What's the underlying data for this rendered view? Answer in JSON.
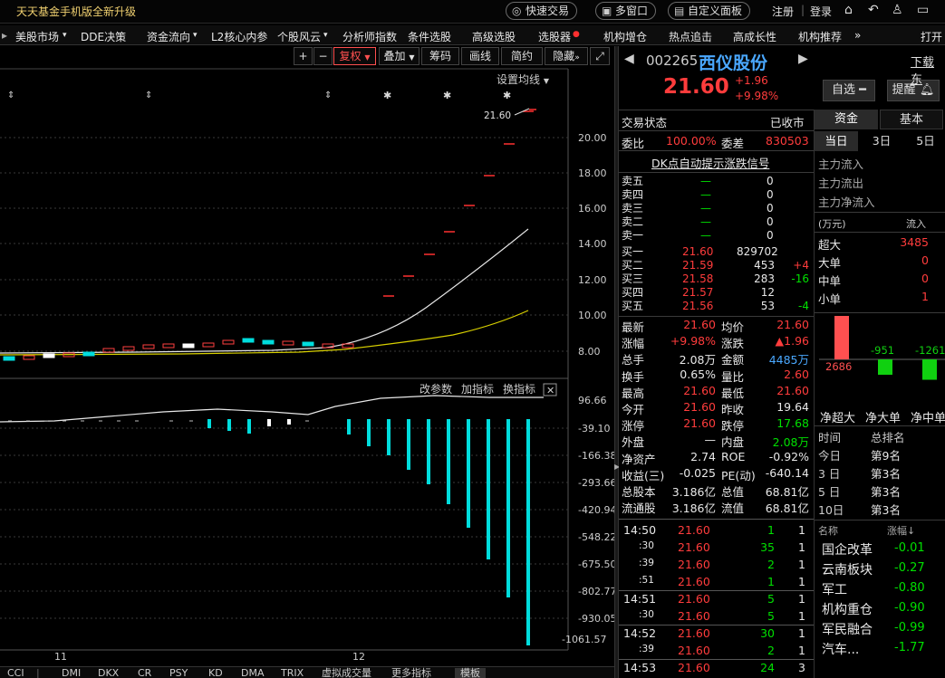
{
  "topbar": {
    "promo": "天天基金手机版全新升级",
    "btn_fast": "快速交易",
    "btn_multi": "多窗口",
    "btn_custom": "自定义面板",
    "register": "注册",
    "login": "登录"
  },
  "menu": [
    "美股市场",
    "DDE决策",
    "资金流向",
    "L2核心内参",
    "个股风云",
    "分析师指数",
    "条件选股",
    "高级选股",
    "选股器",
    "机构增仓",
    "热点追击",
    "高成长性",
    "机构推荐",
    "打开"
  ],
  "chart_toolbar": {
    "plus": "+",
    "minus": "−",
    "fuquan": "复权",
    "overlay": "叠加",
    "chips": "筹码",
    "draw": "画线",
    "simple": "简约",
    "hide": "隐藏",
    "set_ma": "设置均线"
  },
  "chart_labels": {
    "last_price": "21.60",
    "price_ticks": [
      "20.00",
      "18.00",
      "16.00",
      "14.00",
      "12.00",
      "10.00",
      "8.00"
    ],
    "ind_ticks": [
      "96.66",
      "-39.10",
      "-166.38",
      "-293.66",
      "-420.94",
      "-548.22",
      "-675.50",
      "-802.77",
      "-930.05",
      "-1061.57"
    ],
    "x_labels": [
      "11",
      "12"
    ],
    "ind_tools": [
      "改参数",
      "加指标",
      "换指标"
    ]
  },
  "bottom_tabs": [
    "CCI",
    "DMI",
    "DKX",
    "CR",
    "PSY",
    "KD",
    "DMA",
    "TRIX",
    "虚拟成交量",
    "更多指标",
    "模板"
  ],
  "stock": {
    "code": "002265",
    "name": "西仪股份",
    "price": "21.60",
    "change": "+1.96",
    "pct": "+9.98%",
    "add_fav": "自选",
    "alert": "提醒",
    "download": "下载东"
  },
  "quote": {
    "status_label": "交易状态",
    "status": "已收市",
    "wb_label": "委比",
    "wb": "100.00%",
    "wc_label": "委差",
    "wc": "830503",
    "signal": "DK点自动提示涨跌信号",
    "sells": [
      {
        "l": "卖五",
        "p": "—",
        "v": "0"
      },
      {
        "l": "卖四",
        "p": "—",
        "v": "0"
      },
      {
        "l": "卖三",
        "p": "—",
        "v": "0"
      },
      {
        "l": "卖二",
        "p": "—",
        "v": "0"
      },
      {
        "l": "卖一",
        "p": "—",
        "v": "0"
      }
    ],
    "buys": [
      {
        "l": "买一",
        "p": "21.60",
        "v": "829702",
        "d": ""
      },
      {
        "l": "买二",
        "p": "21.59",
        "v": "453",
        "d": "+4"
      },
      {
        "l": "买三",
        "p": "21.58",
        "v": "283",
        "d": "-16"
      },
      {
        "l": "买四",
        "p": "21.57",
        "v": "12",
        "d": ""
      },
      {
        "l": "买五",
        "p": "21.56",
        "v": "53",
        "d": "-4"
      }
    ],
    "stats": [
      {
        "a": "最新",
        "av": "21.60",
        "b": "均价",
        "bv": "21.60"
      },
      {
        "a": "涨幅",
        "av": "+9.98%",
        "b": "涨跌",
        "bv": "▲1.96"
      },
      {
        "a": "总手",
        "av": "2.08万",
        "b": "金额",
        "bv": "4485万"
      },
      {
        "a": "换手",
        "av": "0.65%",
        "b": "量比",
        "bv": "2.60"
      },
      {
        "a": "最高",
        "av": "21.60",
        "b": "最低",
        "bv": "21.60"
      },
      {
        "a": "今开",
        "av": "21.60",
        "b": "昨收",
        "bv": "19.64"
      },
      {
        "a": "涨停",
        "av": "21.60",
        "b": "跌停",
        "bv": "17.68"
      },
      {
        "a": "外盘",
        "av": "—",
        "b": "内盘",
        "bv": "2.08万"
      },
      {
        "a": "净资产",
        "av": "2.74",
        "b": "ROE",
        "bv": "-0.92%"
      },
      {
        "a": "收益(三)",
        "av": "-0.025",
        "b": "PE(动)",
        "bv": "-640.14"
      },
      {
        "a": "总股本",
        "av": "3.186亿",
        "b": "总值",
        "bv": "68.81亿"
      },
      {
        "a": "流通股",
        "av": "3.186亿",
        "b": "流值",
        "bv": "68.81亿"
      }
    ],
    "ticks": [
      {
        "t": "14:50",
        "p": "21.60",
        "v": "1",
        "n": "1"
      },
      {
        "t": ":30",
        "p": "21.60",
        "v": "35",
        "n": "1"
      },
      {
        "t": ":39",
        "p": "21.60",
        "v": "2",
        "n": "1"
      },
      {
        "t": ":51",
        "p": "21.60",
        "v": "1",
        "n": "1"
      },
      {
        "t": "14:51",
        "p": "21.60",
        "v": "5",
        "n": "1"
      },
      {
        "t": ":30",
        "p": "21.60",
        "v": "5",
        "n": "1"
      },
      {
        "t": "14:52",
        "p": "21.60",
        "v": "30",
        "n": "1"
      },
      {
        "t": ":39",
        "p": "21.60",
        "v": "2",
        "n": "1"
      },
      {
        "t": "14:53",
        "p": "21.60",
        "v": "24",
        "n": "3"
      }
    ]
  },
  "fund": {
    "tabs": [
      "资金",
      "基本"
    ],
    "subtabs": [
      "当日",
      "3日",
      "5日"
    ],
    "flows": [
      "主力流入",
      "主力流出",
      "主力净流入"
    ],
    "unit": "(万元)",
    "in_label": "流入",
    "sizes": [
      {
        "l": "超大",
        "v": "3485"
      },
      {
        "l": "大单",
        "v": "0"
      },
      {
        "l": "中单",
        "v": "0"
      },
      {
        "l": "小单",
        "v": "1"
      }
    ],
    "bars": [
      "2686",
      "-951",
      "-1261"
    ],
    "bar_labels": [
      "净超大",
      "净大单",
      "净中单"
    ],
    "rank_head": [
      "时间",
      "总排名"
    ],
    "ranks": [
      {
        "t": "今日",
        "r": "第9名"
      },
      {
        "t": "3 日",
        "r": "第3名"
      },
      {
        "t": "5 日",
        "r": "第3名"
      },
      {
        "t": "10日",
        "r": "第3名"
      }
    ],
    "sect_head": [
      "名称",
      "涨幅"
    ],
    "sectors": [
      {
        "n": "国企改革",
        "v": "-0.01"
      },
      {
        "n": "云南板块",
        "v": "-0.27"
      },
      {
        "n": "军工",
        "v": "-0.80"
      },
      {
        "n": "机构重仓",
        "v": "-0.90"
      },
      {
        "n": "军民融合",
        "v": "-0.99"
      },
      {
        "n": "汽车...",
        "v": "-1.77"
      }
    ]
  }
}
